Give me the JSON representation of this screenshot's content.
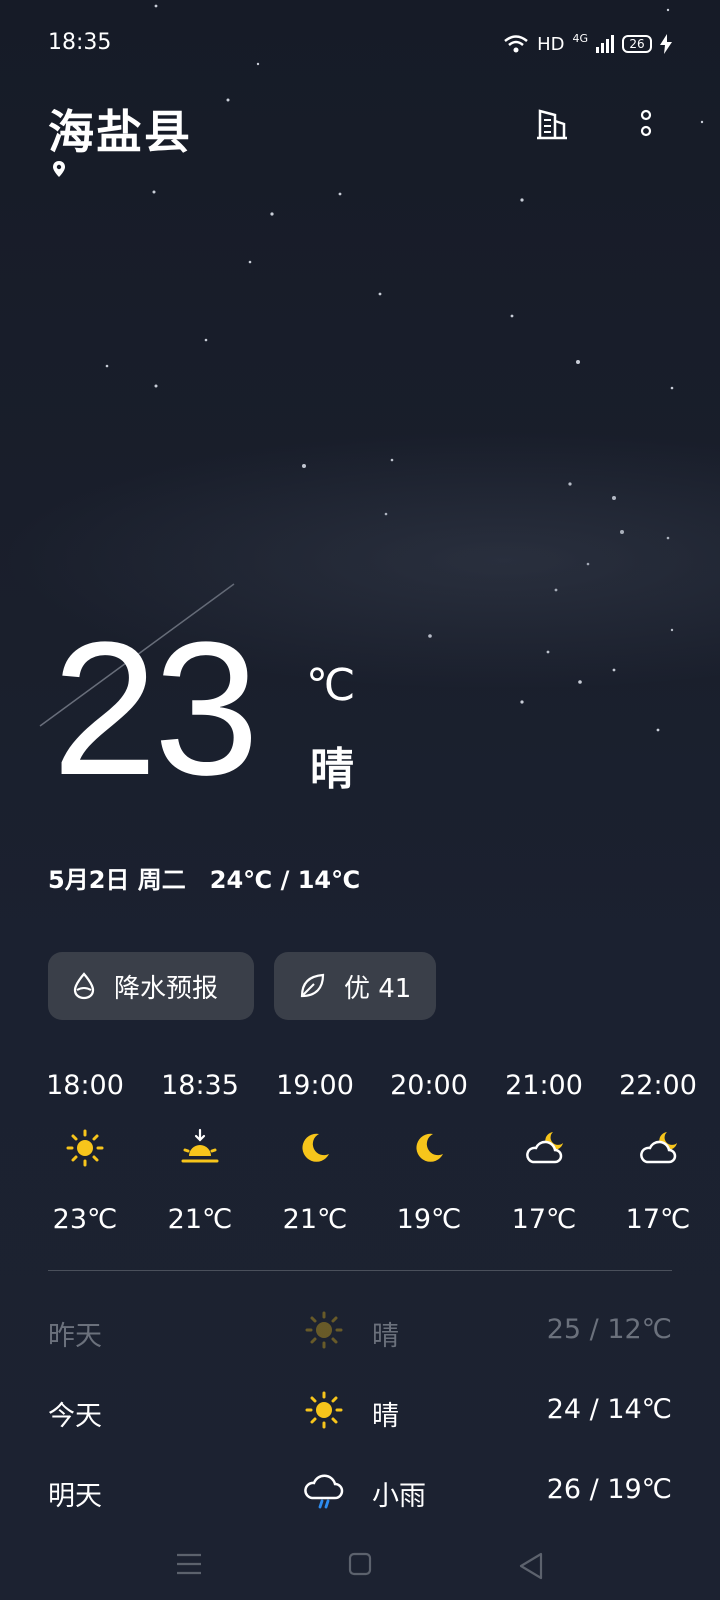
{
  "status_bar": {
    "time": "18:35",
    "network": "HD",
    "signal": "4G",
    "battery": "26"
  },
  "header": {
    "city": "海盐县"
  },
  "current": {
    "temperature": "23",
    "unit": "℃",
    "condition": "晴"
  },
  "date_line": {
    "date": "5月2日 周二",
    "range": "24℃ / 14℃"
  },
  "pills": {
    "precip": "降水预报",
    "air": "优 41"
  },
  "hourly": [
    {
      "time": "18:00",
      "temp": "23℃",
      "icon": "sun-icon"
    },
    {
      "time": "18:35",
      "temp": "21℃",
      "icon": "sunset-icon"
    },
    {
      "time": "19:00",
      "temp": "21℃",
      "icon": "moon-icon"
    },
    {
      "time": "20:00",
      "temp": "19℃",
      "icon": "moon-icon"
    },
    {
      "time": "21:00",
      "temp": "17℃",
      "icon": "cloud-moon-icon"
    },
    {
      "time": "22:00",
      "temp": "17℃",
      "icon": "cloud-moon-icon"
    }
  ],
  "daily": [
    {
      "day": "昨天",
      "condition": "晴",
      "range": "25 / 12℃",
      "icon": "sun-icon"
    },
    {
      "day": "今天",
      "condition": "晴",
      "range": "24 / 14℃",
      "icon": "sun-icon"
    },
    {
      "day": "明天",
      "condition": "小雨",
      "range": "26 / 19℃",
      "icon": "rain-cloud-icon"
    }
  ],
  "colors": {
    "accent_yellow": "#f7c51b",
    "pill_bg": "#3a3f49"
  }
}
